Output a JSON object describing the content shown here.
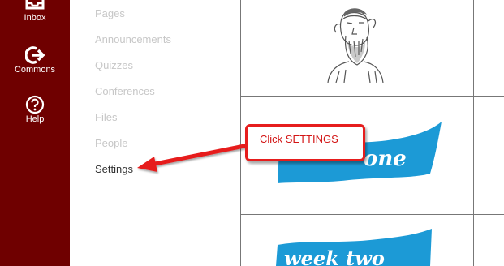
{
  "global_nav": {
    "inbox": "Inbox",
    "commons": "Commons",
    "help": "Help"
  },
  "course_nav": {
    "items": [
      {
        "label": "Pages"
      },
      {
        "label": "Announcements"
      },
      {
        "label": "Quizzes"
      },
      {
        "label": "Conferences"
      },
      {
        "label": "Files"
      },
      {
        "label": "People"
      },
      {
        "label": "Settings"
      }
    ]
  },
  "modules": {
    "banner_1": "one",
    "banner_2": "week two"
  },
  "annotation": {
    "text": "Click SETTINGS"
  },
  "colors": {
    "rail": "#6f0000",
    "banner": "#1c9ad6",
    "annotation": "#e61d1d"
  }
}
